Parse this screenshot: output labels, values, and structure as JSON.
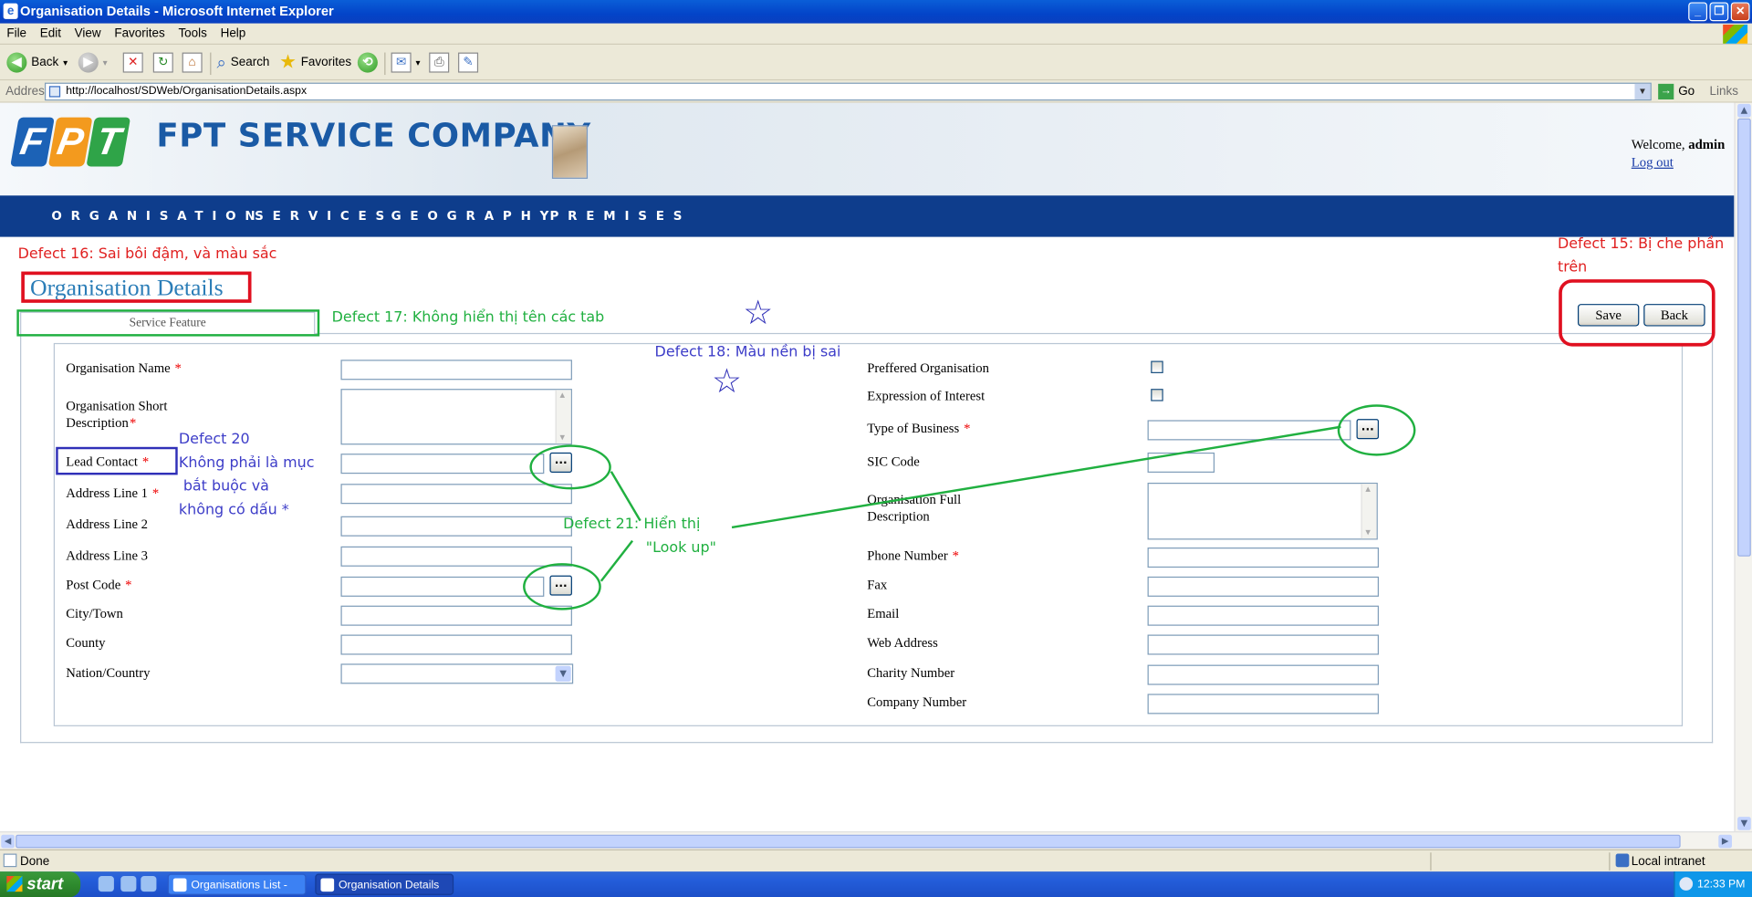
{
  "window": {
    "title": "Organisation Details - Microsoft Internet Explorer",
    "controls": [
      "_",
      "❐",
      "✕"
    ]
  },
  "menu": [
    "File",
    "Edit",
    "View",
    "Favorites",
    "Tools",
    "Help"
  ],
  "toolbar": {
    "back": "Back",
    "search": "Search",
    "favorites": "Favorites"
  },
  "address": {
    "label": "Address",
    "url": "http://localhost/SDWeb/OrganisationDetails.aspx",
    "go": "Go",
    "links": "Links"
  },
  "header": {
    "logo_letters": [
      "F",
      "P",
      "T"
    ],
    "company": "FPT SERVICE COMPANY",
    "welcome_prefix": "Welcome, ",
    "welcome_user": "admin",
    "logout": "Log out"
  },
  "nav": [
    "ORGANISATION",
    "SERVICES",
    "GEOGRAPHY",
    "PREMISES"
  ],
  "page": {
    "title": "Organisation Details",
    "tab": "Service Feature",
    "save": "Save",
    "back": "Back"
  },
  "form_left": {
    "org_name": "Organisation Name",
    "short_desc_1": "Organisation Short",
    "short_desc_2": "Description",
    "lead_contact": "Lead Contact",
    "address1": "Address Line 1",
    "address2": "Address Line 2",
    "address3": "Address Line 3",
    "post_code": "Post Code",
    "city": "City/Town",
    "county": "County",
    "nation": "Nation/Country",
    "required_mark": "*",
    "lookup": "..."
  },
  "form_right": {
    "preferred": "Preffered Organisation",
    "expression": "Expression of Interest",
    "type_business": "Type of Business",
    "sic": "SIC Code",
    "full_desc_1": "Organisation Full",
    "full_desc_2": "Description",
    "phone": "Phone Number",
    "fax": "Fax",
    "email": "Email",
    "web": "Web Address",
    "charity": "Charity Number",
    "company_no": "Company Number"
  },
  "annotations": {
    "d15_line1": "Defect 15: Bị che phần",
    "d15_line2": "trên",
    "d16": "Defect 16: Sai bôi đậm, và màu sắc",
    "d17": "Defect 17: Không hiển thị tên các tab",
    "d18": "Defect 18: Màu nền bị sai",
    "d20_1": "Defect 20",
    "d20_2": "Không phải là mục",
    "d20_3": "bắt buộc và",
    "d20_4": "không có dấu *",
    "d21_1": "Defect 21: Hiển thị",
    "d21_2": "\"Look up\"",
    "star": "☆"
  },
  "status": {
    "text": "Done",
    "zone": "Local intranet"
  },
  "taskbar": {
    "start": "start",
    "tasks": [
      "Organisations List - M...",
      "Organisation Details -..."
    ],
    "clock": "12:33 PM"
  },
  "colors": {
    "nav_bg": "#0e3d8c",
    "title_color": "#2b7db7",
    "defect_red": "#e02020",
    "defect_green": "#20b040",
    "defect_blue": "#3d3dc8"
  }
}
